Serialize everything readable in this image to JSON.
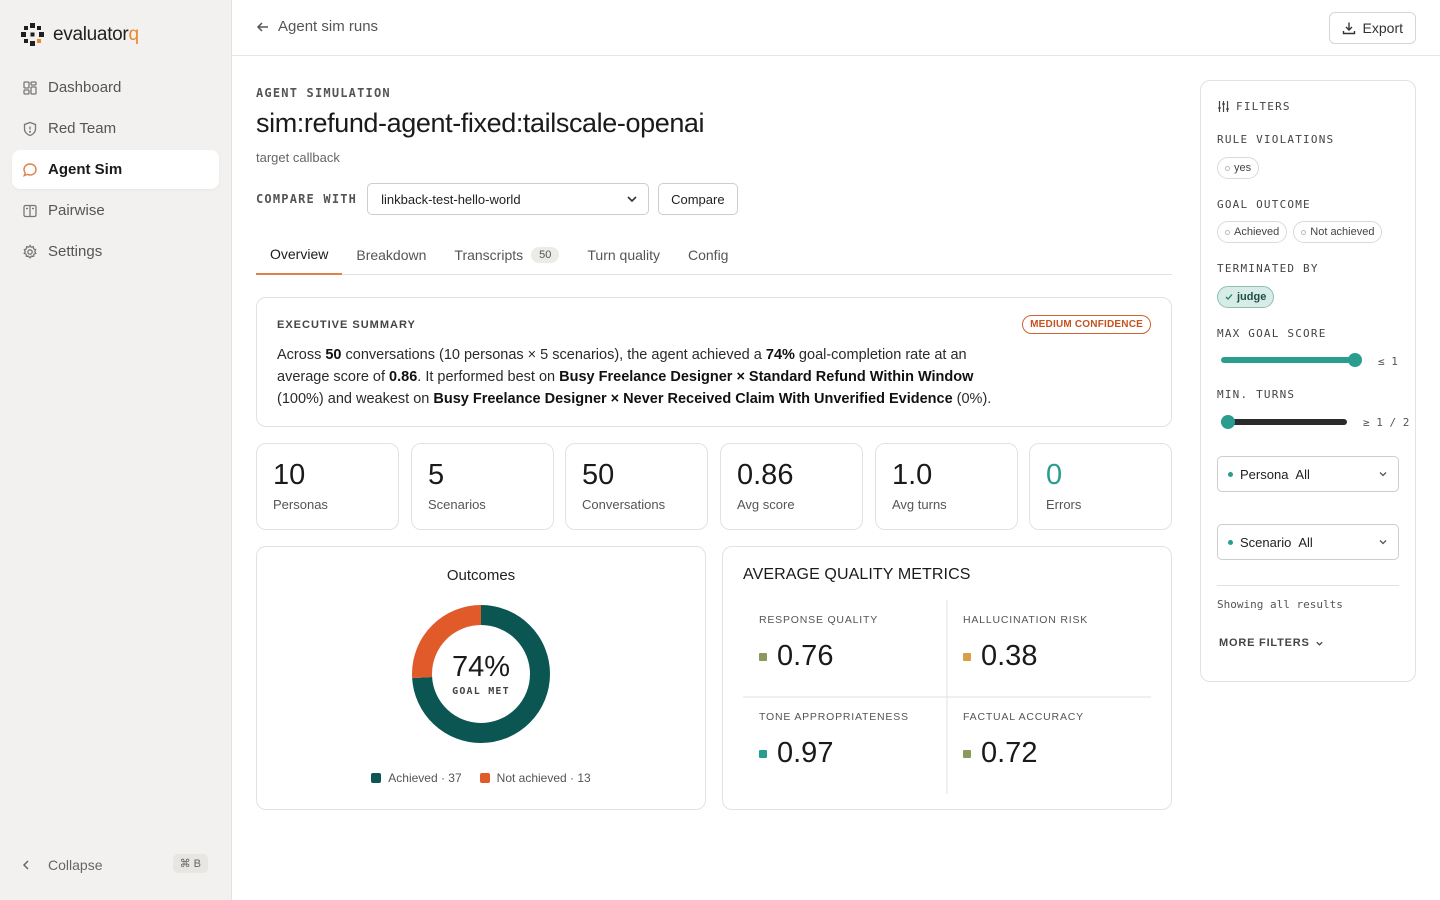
{
  "brand": {
    "name_main": "evaluator",
    "name_accent": "q"
  },
  "sidebar": {
    "items": [
      {
        "label": "Dashboard",
        "active": false
      },
      {
        "label": "Red Team",
        "active": false
      },
      {
        "label": "Agent Sim",
        "active": true
      },
      {
        "label": "Pairwise",
        "active": false
      },
      {
        "label": "Settings",
        "active": false
      }
    ],
    "collapse_label": "Collapse",
    "collapse_shortcut": "⌘ B"
  },
  "topbar": {
    "back_label": "Agent sim runs",
    "export_label": "Export"
  },
  "header": {
    "eyebrow": "AGENT SIMULATION",
    "title": "sim:refund-agent-fixed:tailscale-openai",
    "subtitle": "target callback"
  },
  "compare": {
    "label": "COMPARE WITH",
    "selected": "linkback-test-hello-world",
    "button": "Compare"
  },
  "tabs": [
    {
      "label": "Overview",
      "active": true
    },
    {
      "label": "Breakdown"
    },
    {
      "label": "Transcripts",
      "badge": "50"
    },
    {
      "label": "Turn quality"
    },
    {
      "label": "Config"
    }
  ],
  "executive_summary": {
    "label": "EXECUTIVE SUMMARY",
    "confidence": "MEDIUM CONFIDENCE",
    "t1": "Across ",
    "b1": "50",
    "t2": " conversations (10 personas × 5 scenarios), the agent achieved a ",
    "b2": "74%",
    "t3": " goal-completion rate at an average score of ",
    "b3": "0.86",
    "t4": ". It performed best on ",
    "b4": "Busy Freelance Designer × Standard Refund Within Window",
    "t5": " (100%) and weakest on ",
    "b5": "Busy Freelance Designer × Never Received Claim With Unverified Evidence",
    "t6": " (0%)."
  },
  "stats": [
    {
      "value": "10",
      "label": "Personas"
    },
    {
      "value": "5",
      "label": "Scenarios"
    },
    {
      "value": "50",
      "label": "Conversations"
    },
    {
      "value": "0.86",
      "label": "Avg score"
    },
    {
      "value": "1.0",
      "label": "Avg turns"
    },
    {
      "value": "0",
      "label": "Errors"
    }
  ],
  "outcomes": {
    "title": "Outcomes",
    "center_value": "74%",
    "center_label": "GOAL MET",
    "legend_achieved": "Achieved · 37",
    "legend_not": "Not achieved · 13"
  },
  "chart_data": {
    "type": "pie",
    "categories": [
      "Achieved",
      "Not achieved"
    ],
    "values": [
      37,
      13
    ],
    "colors": [
      "#0b5552",
      "#e05a2a"
    ]
  },
  "metrics": {
    "title": "AVERAGE QUALITY METRICS",
    "items": [
      {
        "label": "RESPONSE QUALITY",
        "value": "0.76",
        "color": "#8a9a5b"
      },
      {
        "label": "HALLUCINATION RISK",
        "value": "0.38",
        "color": "#d9a043"
      },
      {
        "label": "TONE APPROPRIATENESS",
        "value": "0.97",
        "color": "#2a9d8f"
      },
      {
        "label": "FACTUAL ACCURACY",
        "value": "0.72",
        "color": "#8a9a5b"
      }
    ]
  },
  "filters": {
    "title": "FILTERS",
    "rule_violations": {
      "label": "RULE VIOLATIONS",
      "chips": [
        "yes"
      ]
    },
    "goal_outcome": {
      "label": "GOAL OUTCOME",
      "chips": [
        "Achieved",
        "Not achieved"
      ]
    },
    "terminated_by": {
      "label": "TERMINATED BY",
      "chips": [
        "judge"
      ]
    },
    "max_goal_score": {
      "label": "MAX GOAL SCORE",
      "value_text": "≤ 1",
      "level": 1.0
    },
    "min_turns": {
      "label": "MIN. TURNS",
      "value_text": "≥ 1 / 2",
      "level": 0.0
    },
    "persona": {
      "label": "Persona",
      "value": "All"
    },
    "scenario": {
      "label": "Scenario",
      "value": "All"
    },
    "note": "Showing all results",
    "more": "MORE FILTERS"
  },
  "colors": {
    "accent": "#e0804a",
    "teal": "#2a9d8f",
    "dark_teal": "#0b5552",
    "orange": "#e05a2a"
  }
}
